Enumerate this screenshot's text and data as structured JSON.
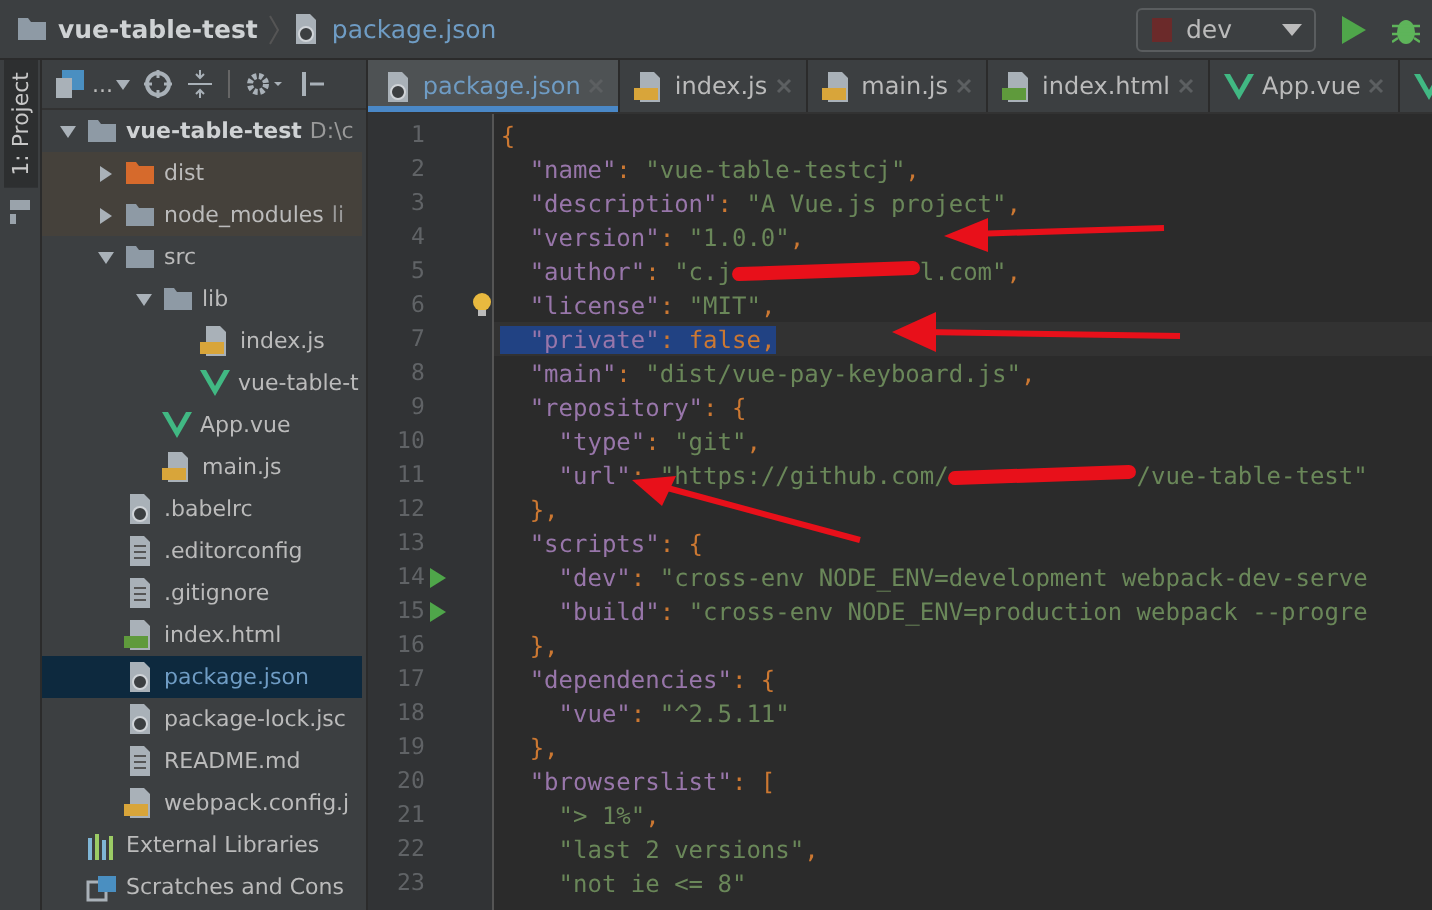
{
  "breadcrumb": [
    {
      "kind": "folder",
      "label": "vue-table-test"
    },
    {
      "kind": "json",
      "label": "package.json"
    }
  ],
  "run_config": {
    "label": "dev"
  },
  "tool_stripe": {
    "label": "1: Project"
  },
  "project_toolbar": {
    "view_label": "..."
  },
  "tabs": [
    {
      "kind": "json",
      "label": "package.json",
      "selected": true
    },
    {
      "kind": "js",
      "label": "index.js",
      "selected": false
    },
    {
      "kind": "js",
      "label": "main.js",
      "selected": false
    },
    {
      "kind": "html",
      "label": "index.html",
      "selected": false
    },
    {
      "kind": "vue",
      "label": "App.vue",
      "selected": false
    },
    {
      "kind": "vue",
      "selected": false
    }
  ],
  "tree": [
    {
      "kind": "folder",
      "label": "vue-table-test",
      "hint": "D:\\c",
      "expanded": true,
      "selected": false,
      "children": [
        {
          "kind": "excluded",
          "label": "dist",
          "expanded": false,
          "selected": false
        },
        {
          "kind": "excluded-folder",
          "label": "node_modules",
          "hint": "li",
          "expanded": false,
          "selected": false
        },
        {
          "kind": "folder",
          "label": "src",
          "expanded": true,
          "selected": false,
          "children": [
            {
              "kind": "folder",
              "label": "lib",
              "expanded": true,
              "selected": false,
              "children": [
                {
                  "kind": "js",
                  "label": "index.js",
                  "selected": false
                },
                {
                  "kind": "vue",
                  "label": "vue-table-t",
                  "selected": false
                }
              ]
            },
            {
              "kind": "vue",
              "label": "App.vue",
              "selected": false
            },
            {
              "kind": "js",
              "label": "main.js",
              "selected": false
            }
          ]
        },
        {
          "kind": "config",
          "label": ".babelrc",
          "selected": false
        },
        {
          "kind": "text",
          "label": ".editorconfig",
          "selected": false
        },
        {
          "kind": "text",
          "label": ".gitignore",
          "selected": false
        },
        {
          "kind": "html",
          "label": "index.html",
          "selected": false
        },
        {
          "kind": "json",
          "label": "package.json",
          "selected": true
        },
        {
          "kind": "json",
          "label": "package-lock.jsc",
          "selected": false
        },
        {
          "kind": "text",
          "label": "README.md",
          "selected": false
        },
        {
          "kind": "js",
          "label": "webpack.config.j",
          "selected": false
        }
      ]
    },
    {
      "kind": "libs",
      "label": "External Libraries",
      "selected": false
    },
    {
      "kind": "scratch",
      "label": "Scratches and Cons",
      "selected": false
    }
  ],
  "code": [
    {
      "n": "1",
      "tokens": [
        {
          "kind": "punct",
          "text": "{"
        }
      ]
    },
    {
      "n": "2",
      "tokens": [
        {
          "kind": "key",
          "text": "  \"name\""
        },
        {
          "kind": "punct",
          "text": ": "
        },
        {
          "kind": "str",
          "text": "\"vue-table-testcj\""
        },
        {
          "kind": "punct",
          "text": ","
        }
      ]
    },
    {
      "n": "3",
      "tokens": [
        {
          "kind": "key",
          "text": "  \"description\""
        },
        {
          "kind": "punct",
          "text": ": "
        },
        {
          "kind": "str",
          "text": "\"A Vue.js project\""
        },
        {
          "kind": "punct",
          "text": ","
        }
      ]
    },
    {
      "n": "4",
      "tokens": [
        {
          "kind": "key",
          "text": "  \"version\""
        },
        {
          "kind": "punct",
          "text": ": "
        },
        {
          "kind": "str",
          "text": "\"1.0.0\""
        },
        {
          "kind": "punct",
          "text": ","
        }
      ]
    },
    {
      "n": "5",
      "tokens": [
        {
          "kind": "key",
          "text": "  \"author\""
        },
        {
          "kind": "punct",
          "text": ": "
        },
        {
          "kind": "str",
          "text": "\"c.j"
        },
        {
          "kind": "hidden"
        },
        {
          "kind": "str",
          "text": "l.com\""
        },
        {
          "kind": "punct",
          "text": ","
        }
      ]
    },
    {
      "n": "6",
      "hint": true,
      "tokens": [
        {
          "kind": "key",
          "text": "  \"license\""
        },
        {
          "kind": "punct",
          "text": ": "
        },
        {
          "kind": "str",
          "text": "\"MIT\""
        },
        {
          "kind": "punct",
          "text": ","
        }
      ]
    },
    {
      "n": "7",
      "selected": true,
      "tokens": [
        {
          "kind": "key",
          "text": "  \"private\""
        },
        {
          "kind": "punct",
          "text": ": "
        },
        {
          "kind": "bool",
          "text": "false"
        },
        {
          "kind": "punct",
          "text": ","
        }
      ]
    },
    {
      "n": "8",
      "tokens": [
        {
          "kind": "key",
          "text": "  \"main\""
        },
        {
          "kind": "punct",
          "text": ": "
        },
        {
          "kind": "str",
          "text": "\"dist/vue-pay-keyboard.js\""
        },
        {
          "kind": "punct",
          "text": ","
        }
      ]
    },
    {
      "n": "9",
      "tokens": [
        {
          "kind": "key",
          "text": "  \"repository\""
        },
        {
          "kind": "punct",
          "text": ": {"
        }
      ]
    },
    {
      "n": "10",
      "tokens": [
        {
          "kind": "key",
          "text": "    \"type\""
        },
        {
          "kind": "punct",
          "text": ": "
        },
        {
          "kind": "str",
          "text": "\"git\""
        },
        {
          "kind": "punct",
          "text": ","
        }
      ]
    },
    {
      "n": "11",
      "tokens": [
        {
          "kind": "key",
          "text": "    \"url\""
        },
        {
          "kind": "punct",
          "text": ": "
        },
        {
          "kind": "str",
          "text": "\"https://github.com/"
        },
        {
          "kind": "hidden"
        },
        {
          "kind": "str",
          "text": "/vue-table-test\""
        }
      ]
    },
    {
      "n": "12",
      "tokens": [
        {
          "kind": "punct",
          "text": "  },"
        }
      ]
    },
    {
      "n": "13",
      "tokens": [
        {
          "kind": "key",
          "text": "  \"scripts\""
        },
        {
          "kind": "punct",
          "text": ": {"
        }
      ]
    },
    {
      "n": "14",
      "run": true,
      "tokens": [
        {
          "kind": "key",
          "text": "    \"dev\""
        },
        {
          "kind": "punct",
          "text": ": "
        },
        {
          "kind": "str",
          "text": "\"cross-env NODE_ENV=development webpack-dev-serve"
        }
      ]
    },
    {
      "n": "15",
      "run": true,
      "tokens": [
        {
          "kind": "key",
          "text": "    \"build\""
        },
        {
          "kind": "punct",
          "text": ": "
        },
        {
          "kind": "str",
          "text": "\"cross-env NODE_ENV=production webpack --progre"
        }
      ]
    },
    {
      "n": "16",
      "tokens": [
        {
          "kind": "punct",
          "text": "  },"
        }
      ]
    },
    {
      "n": "17",
      "tokens": [
        {
          "kind": "key",
          "text": "  \"dependencies\""
        },
        {
          "kind": "punct",
          "text": ": {"
        }
      ]
    },
    {
      "n": "18",
      "tokens": [
        {
          "kind": "key",
          "text": "    \"vue\""
        },
        {
          "kind": "punct",
          "text": ": "
        },
        {
          "kind": "str",
          "text": "\"^2.5.11\""
        }
      ]
    },
    {
      "n": "19",
      "tokens": [
        {
          "kind": "punct",
          "text": "  },"
        }
      ]
    },
    {
      "n": "20",
      "tokens": [
        {
          "kind": "key",
          "text": "  \"browserslist\""
        },
        {
          "kind": "punct",
          "text": ": ["
        }
      ]
    },
    {
      "n": "21",
      "tokens": [
        {
          "kind": "str",
          "text": "    \"> 1%\""
        },
        {
          "kind": "punct",
          "text": ","
        }
      ]
    },
    {
      "n": "22",
      "tokens": [
        {
          "kind": "str",
          "text": "    \"last 2 versions\""
        },
        {
          "kind": "punct",
          "text": ","
        }
      ]
    },
    {
      "n": "23",
      "tokens": [
        {
          "kind": "str",
          "text": "    \"not ie <= 8\""
        }
      ]
    }
  ]
}
